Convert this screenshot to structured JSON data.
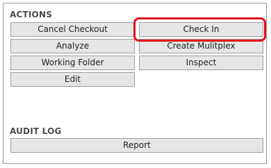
{
  "actions": {
    "title": "ACTIONS",
    "buttons": {
      "cancel_checkout": "Cancel Checkout",
      "check_in": "Check In",
      "analyze": "Analyze",
      "create_multiplex": "Create Mulitplex",
      "working_folder": "Working Folder",
      "inspect": "Inspect",
      "edit": "Edit"
    }
  },
  "audit_log": {
    "title": "AUDIT LOG",
    "buttons": {
      "report": "Report"
    }
  },
  "colors": {
    "highlight": "#e0111b",
    "button_bg": "#e6e6e6",
    "button_border": "#9d9d9d"
  }
}
